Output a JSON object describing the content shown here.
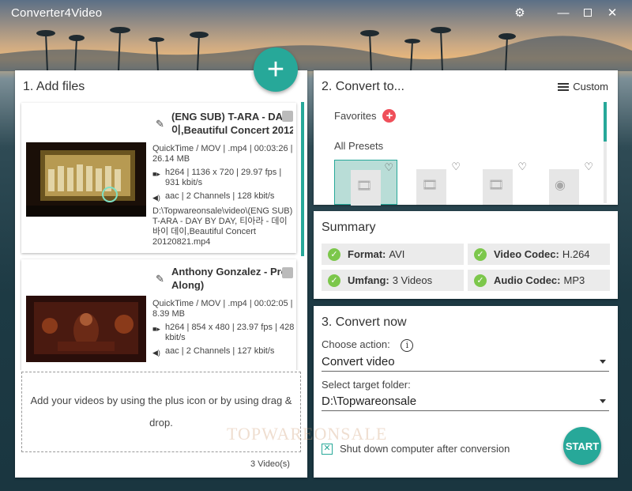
{
  "window": {
    "title": "Converter4Video"
  },
  "add_files": {
    "title": "1. Add files",
    "fab": "+",
    "files": [
      {
        "name_line1": "(ENG SUB) T-ARA - DAY BY DAY",
        "name_line2": "이,Beautiful Concert 2012",
        "container": "QuickTime / MOV | .mp4 | 00:03:26 | 26.14 MB",
        "video": "h264 | 1136 x 720 | 29.97 fps | 931 kbit/s",
        "audio": "aac | 2 Channels | 128 kbit/s",
        "path": "D:\\Topwareonsale\\video\\(ENG SUB) T-ARA - DAY BY DAY, 티아라 - 데이 바이 데이,Beautiful Concert 20120821.mp4"
      },
      {
        "name_line1": "Anthony Gonzalez - Proud",
        "name_line2": "Along)",
        "container": "QuickTime / MOV | .mp4 | 00:02:05 | 8.39 MB",
        "video": "h264 | 854 x 480 | 23.97 fps | 428 kbit/s",
        "audio": "aac | 2 Channels | 127 kbit/s"
      }
    ],
    "dropzone_text": "Add your videos by using the plus icon or by using drag & drop.",
    "video_count": "3 Video(s)"
  },
  "convert_to": {
    "title": "2. Convert to...",
    "custom_label": "Custom",
    "favorites_label": "Favorites",
    "all_presets_label": "All Presets"
  },
  "summary": {
    "title": "Summary",
    "items": [
      {
        "key": "Format:",
        "value": "AVI"
      },
      {
        "key": "Video Codec:",
        "value": "H.264"
      },
      {
        "key": "Umfang:",
        "value": "3 Videos"
      },
      {
        "key": "Audio Codec:",
        "value": "MP3"
      }
    ]
  },
  "convert_now": {
    "title": "3. Convert now",
    "choose_action_label": "Choose action:",
    "choose_action_value": "Convert video",
    "target_folder_label": "Select target folder:",
    "target_folder_value": "D:\\Topwareonsale",
    "shutdown_label": "Shut down computer after conversion",
    "start_label": "START"
  },
  "watermark": "TOPWAREONSALE",
  "colors": {
    "accent": "#27a899",
    "favorite": "#ef4f5a",
    "check": "#7cc74b"
  }
}
